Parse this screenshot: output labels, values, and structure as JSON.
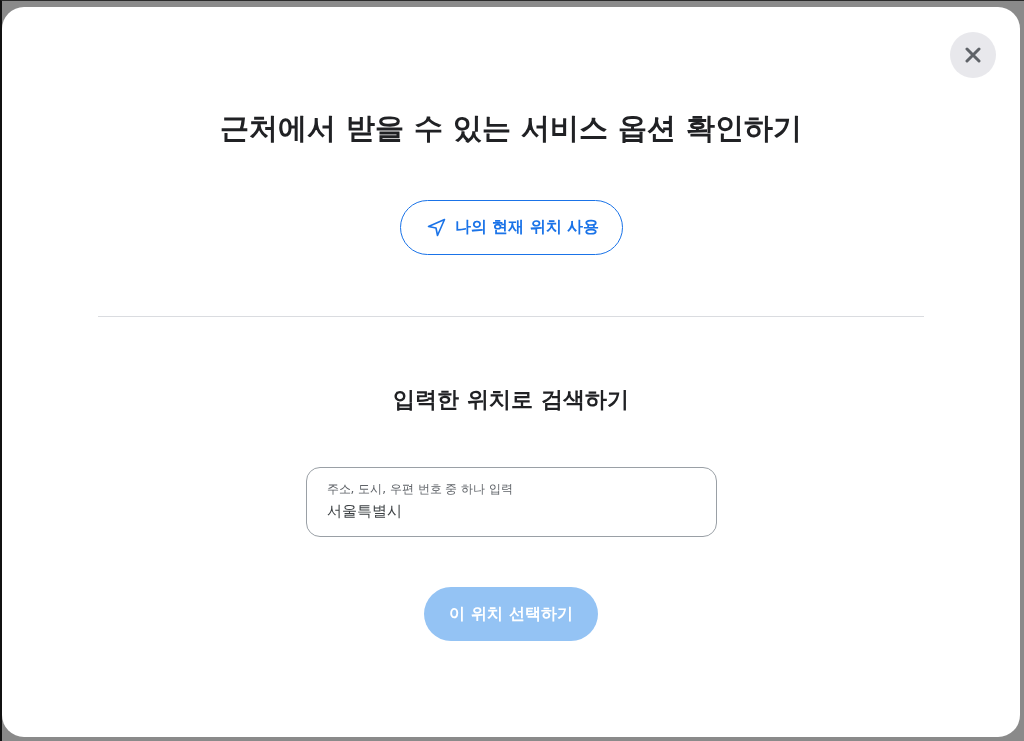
{
  "dialog": {
    "title": "근처에서 받을 수 있는 서비스 옵션 확인하기",
    "location_button": {
      "label": "나의 현재 위치 사용"
    },
    "search": {
      "heading": "입력한 위치로 검색하기",
      "field": {
        "label": "주소, 도시, 우편 번호 중 하나 입력",
        "value": "서울특별시"
      },
      "submit_button": {
        "label": "이 위치 선택하기",
        "disabled": true
      }
    }
  }
}
